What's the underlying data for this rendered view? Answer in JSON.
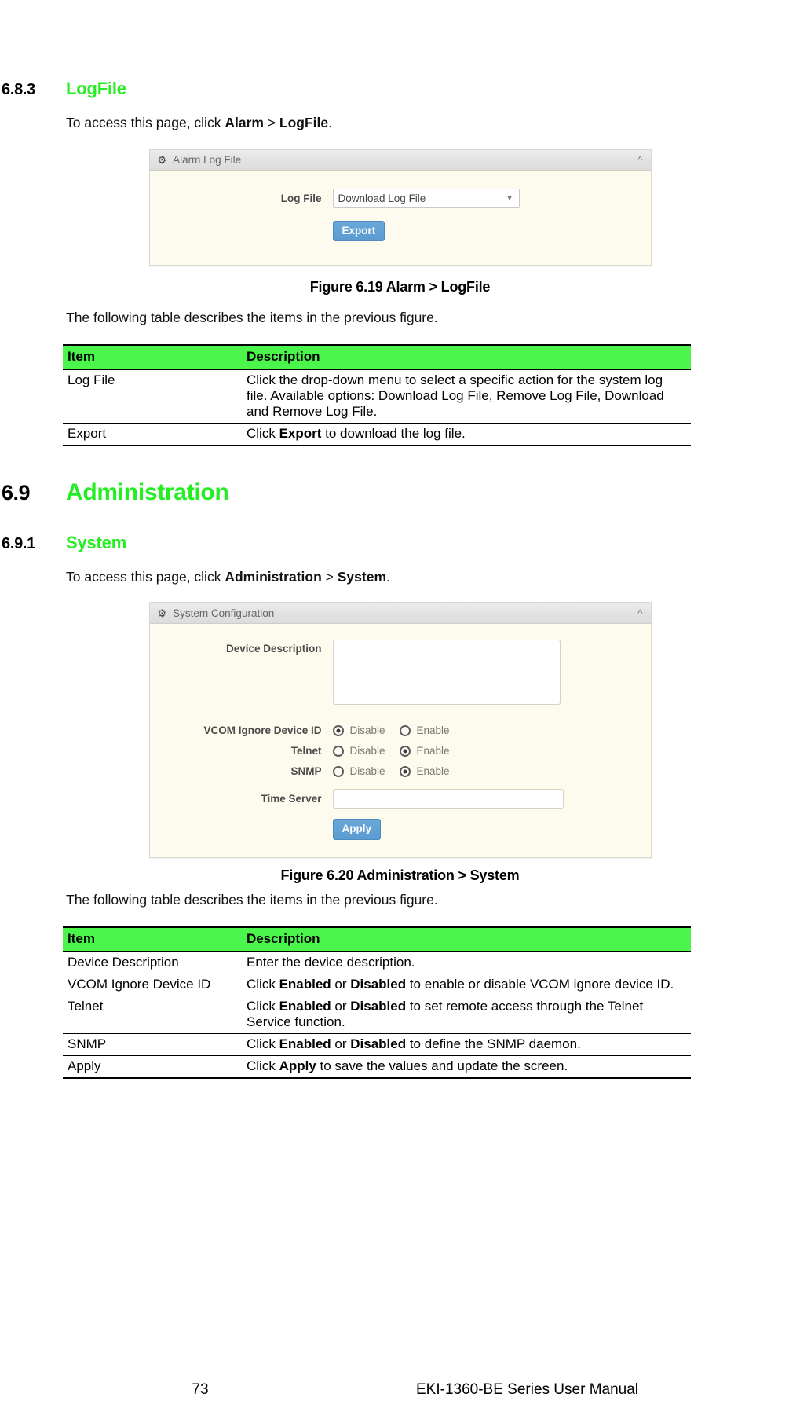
{
  "sections": {
    "logfile": {
      "number": "6.8.3",
      "title": "LogFile",
      "intro_prefix": "To access this page, click ",
      "intro_b1": "Alarm",
      "intro_sep": " > ",
      "intro_b2": "LogFile",
      "intro_suffix": "."
    },
    "administration": {
      "number": "6.9",
      "title": "Administration"
    },
    "system": {
      "number": "6.9.1",
      "title": "System",
      "intro_prefix": "To access this page, click ",
      "intro_b1": "Administration",
      "intro_sep": " > ",
      "intro_b2": "System",
      "intro_suffix": "."
    }
  },
  "figure1": {
    "panel_title": "Alarm Log File",
    "gear_icon": "gear-icon",
    "chevron_icon": "chevron-up-icon",
    "log_file_label": "Log File",
    "log_file_value": "Download Log File",
    "log_file_options": [
      "Download Log File",
      "Remove Log File",
      "Download and Remove Log File"
    ],
    "export_button": "Export",
    "caption": "Figure 6.19 Alarm > LogFile"
  },
  "figure2": {
    "panel_title": "System Configuration",
    "gear_icon": "gear-icon",
    "chevron_icon": "chevron-up-icon",
    "device_description_label": "Device Description",
    "device_description_value": "",
    "vcom_label": "VCOM Ignore Device ID",
    "telnet_label": "Telnet",
    "snmp_label": "SNMP",
    "radio_disable": "Disable",
    "radio_enable": "Enable",
    "vcom_selected": "Disable",
    "telnet_selected": "Enable",
    "snmp_selected": "Enable",
    "time_server_label": "Time Server",
    "time_server_value": "",
    "apply_button": "Apply",
    "caption": "Figure 6.20 Administration > System"
  },
  "table_intro": "The following table describes the items in the previous figure.",
  "table1": {
    "headers": [
      "Item",
      "Description"
    ],
    "rows": [
      {
        "item": "Log File",
        "desc_parts": [
          {
            "text": "Click the drop-down menu to select a specific action for the system log file. Available options: Download Log File, Remove Log File, Download and Remove Log File.",
            "bold": false
          }
        ]
      },
      {
        "item": "Export",
        "desc_parts": [
          {
            "text": "Click ",
            "bold": false
          },
          {
            "text": "Export",
            "bold": true
          },
          {
            "text": " to download the log file.",
            "bold": false
          }
        ]
      }
    ]
  },
  "table2": {
    "headers": [
      "Item",
      "Description"
    ],
    "rows": [
      {
        "item": "Device Description",
        "desc_parts": [
          {
            "text": "Enter the device description.",
            "bold": false
          }
        ]
      },
      {
        "item": "VCOM Ignore Device ID",
        "desc_parts": [
          {
            "text": "Click ",
            "bold": false
          },
          {
            "text": "Enabled",
            "bold": true
          },
          {
            "text": " or ",
            "bold": false
          },
          {
            "text": "Disabled",
            "bold": true
          },
          {
            "text": " to enable or disable VCOM ignore device ID.",
            "bold": false
          }
        ]
      },
      {
        "item": "Telnet",
        "desc_parts": [
          {
            "text": "Click ",
            "bold": false
          },
          {
            "text": "Enabled",
            "bold": true
          },
          {
            "text": " or ",
            "bold": false
          },
          {
            "text": "Disabled",
            "bold": true
          },
          {
            "text": " to set remote access through the Telnet Service function.",
            "bold": false
          }
        ]
      },
      {
        "item": "SNMP",
        "desc_parts": [
          {
            "text": "Click ",
            "bold": false
          },
          {
            "text": "Enabled",
            "bold": true
          },
          {
            "text": " or ",
            "bold": false
          },
          {
            "text": "Disabled",
            "bold": true
          },
          {
            "text": " to define the SNMP daemon.",
            "bold": false
          }
        ]
      },
      {
        "item": "Apply",
        "desc_parts": [
          {
            "text": "Click ",
            "bold": false
          },
          {
            "text": "Apply",
            "bold": true
          },
          {
            "text": " to save the values and update the screen.",
            "bold": false
          }
        ]
      }
    ]
  },
  "footer": {
    "page_number": "73",
    "manual_title": "EKI-1360-BE Series User Manual"
  },
  "colors": {
    "heading_green": "#22ee22",
    "table_header_green": "#4cf54c",
    "panel_body": "#fcfbee",
    "button_blue": "#5b9bd0"
  }
}
